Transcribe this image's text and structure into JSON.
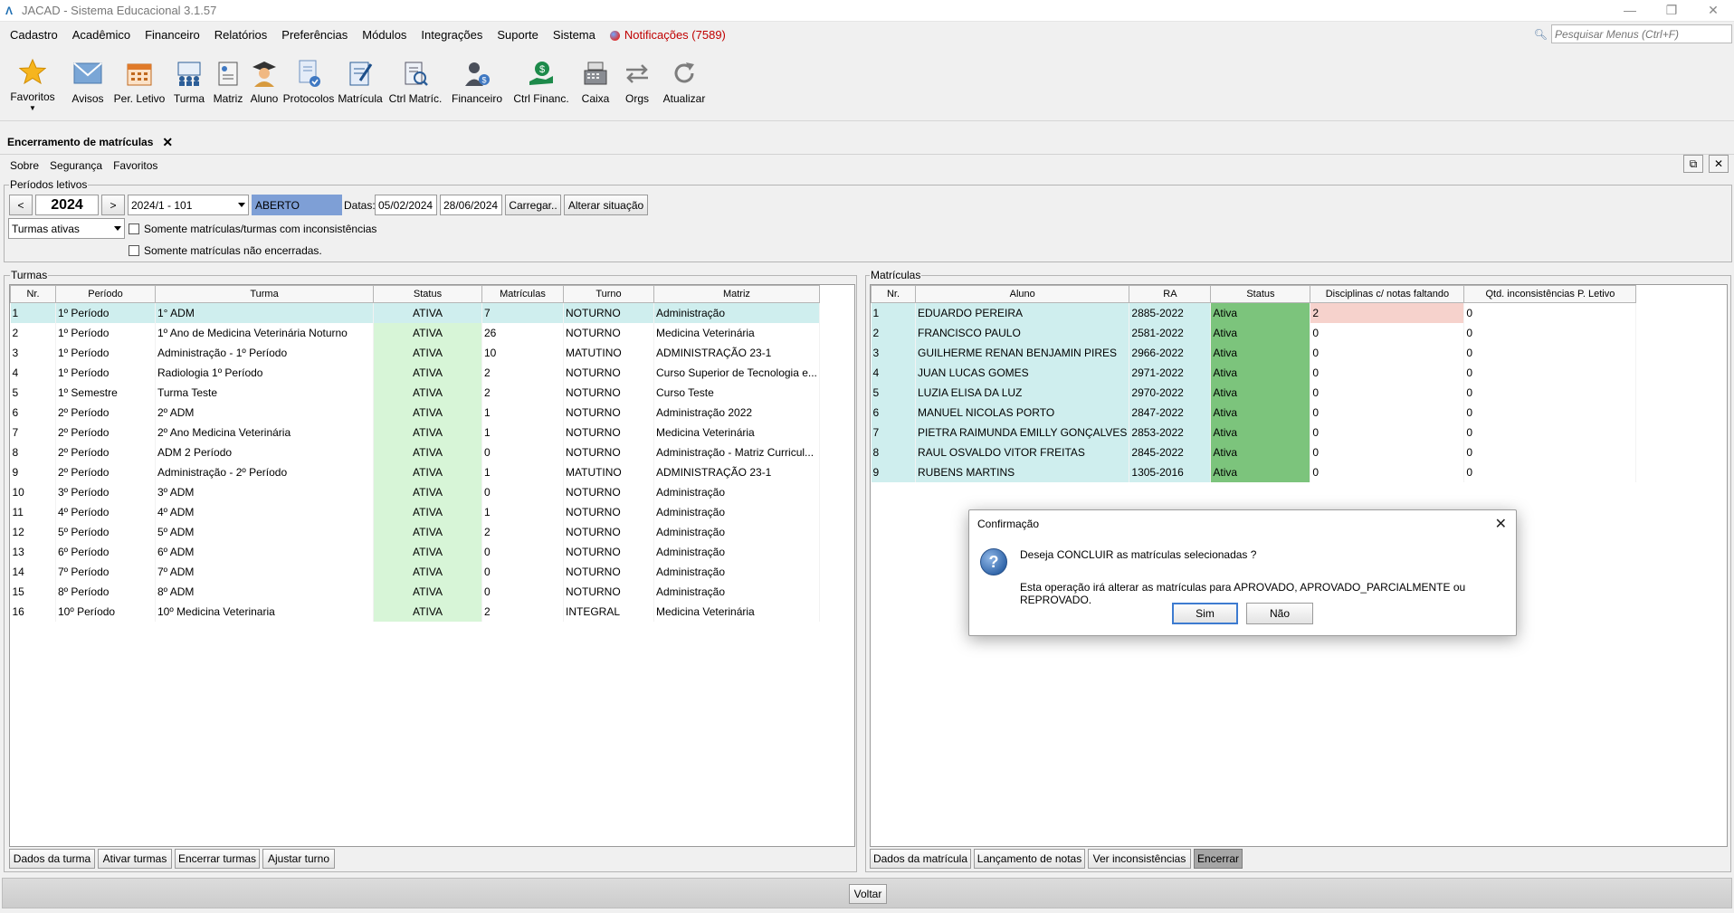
{
  "window": {
    "title": "JACAD - Sistema Educacional 3.1.57",
    "minimize": "—",
    "restore": "❐",
    "close": "✕"
  },
  "menu": {
    "items": [
      "Cadastro",
      "Acadêmico",
      "Financeiro",
      "Relatórios",
      "Preferências",
      "Módulos",
      "Integrações",
      "Suporte",
      "Sistema"
    ],
    "notifications": "Notificações (7589)",
    "search_placeholder": "Pesquisar Menus (Ctrl+F)"
  },
  "toolbar": {
    "items": [
      {
        "label": "Favoritos",
        "icon": "star-icon"
      },
      {
        "label": "Avisos",
        "icon": "envelope-icon"
      },
      {
        "label": "Per. Letivo",
        "icon": "calendar-icon"
      },
      {
        "label": "Turma",
        "icon": "class-group-icon"
      },
      {
        "label": "Matriz",
        "icon": "curriculum-icon"
      },
      {
        "label": "Aluno",
        "icon": "student-icon"
      },
      {
        "label": "Protocolos",
        "icon": "protocol-icon"
      },
      {
        "label": "Matrícula",
        "icon": "enrollment-icon"
      },
      {
        "label": "Ctrl Matríc.",
        "icon": "enrollment-control-icon"
      },
      {
        "label": "Financeiro",
        "icon": "finance-icon"
      },
      {
        "label": "Ctrl Financ.",
        "icon": "finance-control-icon"
      },
      {
        "label": "Caixa",
        "icon": "cash-register-icon"
      },
      {
        "label": "Orgs",
        "icon": "transfer-arrows-icon"
      },
      {
        "label": "Atualizar",
        "icon": "refresh-icon"
      }
    ]
  },
  "doc_tab": {
    "label": "Encerramento de matrículas",
    "close": "✕"
  },
  "submenu": [
    "Sobre",
    "Segurança",
    "Favoritos"
  ],
  "periodos": {
    "title": "Períodos letivos",
    "prev": "<",
    "next": ">",
    "year": "2024",
    "period": "2024/1 - 101",
    "situacao": "ABERTO",
    "datas_label": "Datas:",
    "data_inicio": "05/02/2024",
    "data_fim": "28/06/2024",
    "carregar": "Carregar..",
    "alterar": "Alterar situação",
    "filtro": "Turmas ativas",
    "chk1": "Somente matrículas/turmas com inconsistências",
    "chk2": "Somente matrículas não encerradas."
  },
  "turmas": {
    "title": "Turmas",
    "columns": [
      "Nr.",
      "Período",
      "Turma",
      "Status",
      "Matrículas",
      "Turno",
      "Matriz"
    ],
    "rows": [
      [
        "1",
        "1º Período",
        "1° ADM",
        "ATIVA",
        "7",
        "NOTURNO",
        "Administração"
      ],
      [
        "2",
        "1º Período",
        "1º Ano de Medicina Veterinária Noturno",
        "ATIVA",
        "26",
        "NOTURNO",
        "Medicina Veterinária"
      ],
      [
        "3",
        "1º Período",
        "Administração - 1º Período",
        "ATIVA",
        "10",
        "MATUTINO",
        "ADMINISTRAÇÃO 23-1"
      ],
      [
        "4",
        "1º Período",
        "Radiologia 1º Período",
        "ATIVA",
        "2",
        "NOTURNO",
        "Curso Superior de Tecnologia e..."
      ],
      [
        "5",
        "1º Semestre",
        "Turma Teste",
        "ATIVA",
        "2",
        "NOTURNO",
        "Curso Teste"
      ],
      [
        "6",
        "2º Período",
        "2º ADM",
        "ATIVA",
        "1",
        "NOTURNO",
        "Administração 2022"
      ],
      [
        "7",
        "2º Período",
        "2º Ano Medicina Veterinária",
        "ATIVA",
        "1",
        "NOTURNO",
        "Medicina Veterinária"
      ],
      [
        "8",
        "2º Período",
        "ADM 2 Período",
        "ATIVA",
        "0",
        "NOTURNO",
        "Administração - Matriz Curricul..."
      ],
      [
        "9",
        "2º Período",
        "Administração - 2º Período",
        "ATIVA",
        "1",
        "MATUTINO",
        "ADMINISTRAÇÃO 23-1"
      ],
      [
        "10",
        "3º Período",
        "3º ADM",
        "ATIVA",
        "0",
        "NOTURNO",
        "Administração"
      ],
      [
        "11",
        "4º Período",
        "4º ADM",
        "ATIVA",
        "1",
        "NOTURNO",
        "Administração"
      ],
      [
        "12",
        "5º Período",
        "5º ADM",
        "ATIVA",
        "2",
        "NOTURNO",
        "Administração"
      ],
      [
        "13",
        "6º Período",
        "6º ADM",
        "ATIVA",
        "0",
        "NOTURNO",
        "Administração"
      ],
      [
        "14",
        "7º Período",
        "7º ADM",
        "ATIVA",
        "0",
        "NOTURNO",
        "Administração"
      ],
      [
        "15",
        "8º Período",
        "8º ADM",
        "ATIVA",
        "0",
        "NOTURNO",
        "Administração"
      ],
      [
        "16",
        "10º Período",
        "10º  Medicina Veterinaria",
        "ATIVA",
        "2",
        "INTEGRAL",
        "Medicina Veterinária"
      ]
    ],
    "buttons": [
      "Dados da turma",
      "Ativar turmas",
      "Encerrar turmas",
      "Ajustar turno"
    ]
  },
  "matriculas": {
    "title": "Matrículas",
    "columns": [
      "Nr.",
      "Aluno",
      "RA",
      "Status",
      "Disciplinas c/ notas faltando",
      "Qtd. inconsistências P. Letivo"
    ],
    "rows": [
      [
        "1",
        "EDUARDO PEREIRA",
        "2885-2022",
        "Ativa",
        "2",
        "0"
      ],
      [
        "2",
        "FRANCISCO PAULO",
        "2581-2022",
        "Ativa",
        "0",
        "0"
      ],
      [
        "3",
        "GUILHERME RENAN BENJAMIN PIRES",
        "2966-2022",
        "Ativa",
        "0",
        "0"
      ],
      [
        "4",
        "JUAN LUCAS GOMES",
        "2971-2022",
        "Ativa",
        "0",
        "0"
      ],
      [
        "5",
        "LUZIA ELISA DA LUZ",
        "2970-2022",
        "Ativa",
        "0",
        "0"
      ],
      [
        "6",
        "MANUEL NICOLAS PORTO",
        "2847-2022",
        "Ativa",
        "0",
        "0"
      ],
      [
        "7",
        "PIETRA RAIMUNDA EMILLY GONÇALVES",
        "2853-2022",
        "Ativa",
        "0",
        "0"
      ],
      [
        "8",
        "RAUL OSVALDO VITOR FREITAS",
        "2845-2022",
        "Ativa",
        "0",
        "0"
      ],
      [
        "9",
        "RUBENS MARTINS",
        "1305-2016",
        "Ativa",
        "0",
        "0"
      ]
    ],
    "buttons": [
      "Dados da matrícula",
      "Lançamento de notas",
      "Ver inconsistências",
      "Encerrar"
    ]
  },
  "footer": {
    "voltar": "Voltar"
  },
  "dialog": {
    "title": "Confirmação",
    "close": "✕",
    "icon": "?",
    "message": "Deseja CONCLUIR as matrículas selecionadas ?",
    "detail": "Esta operação irá alterar as matrículas para APROVADO, APROVADO_PARCIALMENTE ou REPROVADO.",
    "yes": "Sim",
    "no": "Não"
  }
}
